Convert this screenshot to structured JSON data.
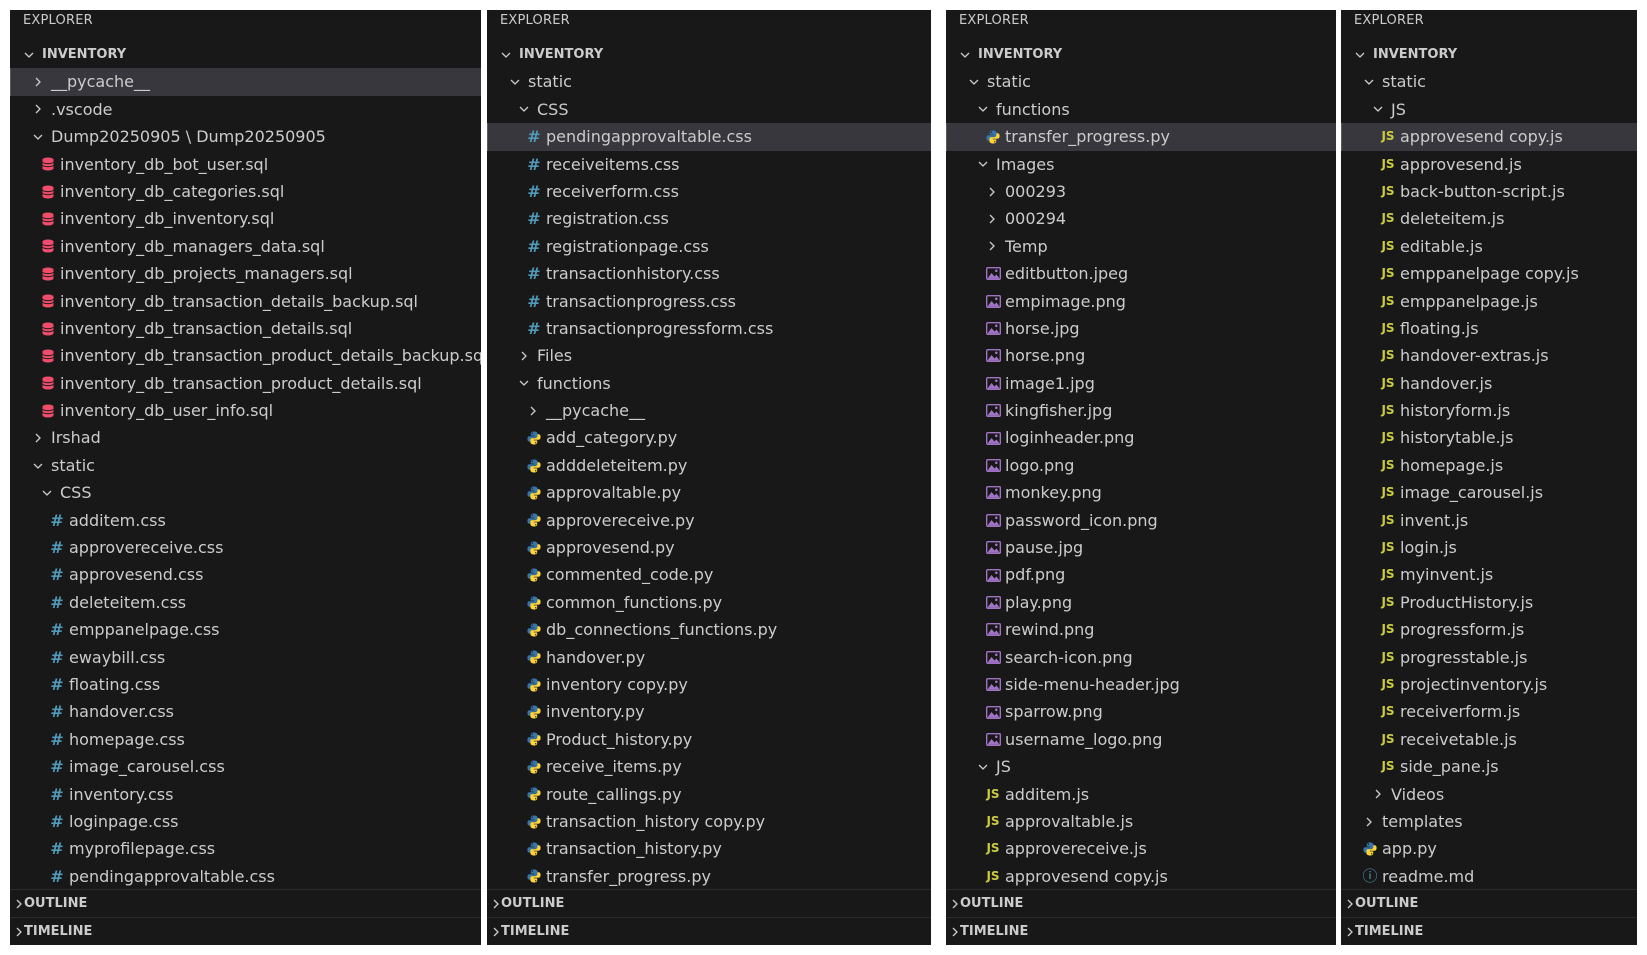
{
  "colors": {
    "panel_bg": "#181818",
    "selected_row": "#37373d",
    "css_hash": "#519aba",
    "js_badge": "#cbcb41",
    "python_blue": "#3776ab",
    "python_yellow": "#ffd43b",
    "database": "#f14c6c",
    "image": "#a074c4"
  },
  "panels": [
    {
      "header": "EXPLORER",
      "rows": [
        {
          "label": "INVENTORY",
          "depth": 0,
          "kind": "root",
          "icon": "chevron-down"
        },
        {
          "label": "__pycache__",
          "depth": 1,
          "kind": "folder",
          "icon": "chevron-right",
          "selected": true
        },
        {
          "label": ".vscode",
          "depth": 1,
          "kind": "folder",
          "icon": "chevron-right"
        },
        {
          "label": "Dump20250905 \\ Dump20250905",
          "depth": 1,
          "kind": "folder",
          "icon": "chevron-down"
        },
        {
          "label": "inventory_db_bot_user.sql",
          "depth": 2,
          "kind": "file",
          "icon": "database"
        },
        {
          "label": "inventory_db_categories.sql",
          "depth": 2,
          "kind": "file",
          "icon": "database"
        },
        {
          "label": "inventory_db_inventory.sql",
          "depth": 2,
          "kind": "file",
          "icon": "database"
        },
        {
          "label": "inventory_db_managers_data.sql",
          "depth": 2,
          "kind": "file",
          "icon": "database"
        },
        {
          "label": "inventory_db_projects_managers.sql",
          "depth": 2,
          "kind": "file",
          "icon": "database"
        },
        {
          "label": "inventory_db_transaction_details_backup.sql",
          "depth": 2,
          "kind": "file",
          "icon": "database"
        },
        {
          "label": "inventory_db_transaction_details.sql",
          "depth": 2,
          "kind": "file",
          "icon": "database"
        },
        {
          "label": "inventory_db_transaction_product_details_backup.sql",
          "depth": 2,
          "kind": "file",
          "icon": "database"
        },
        {
          "label": "inventory_db_transaction_product_details.sql",
          "depth": 2,
          "kind": "file",
          "icon": "database"
        },
        {
          "label": "inventory_db_user_info.sql",
          "depth": 2,
          "kind": "file",
          "icon": "database"
        },
        {
          "label": "Irshad",
          "depth": 1,
          "kind": "folder",
          "icon": "chevron-right"
        },
        {
          "label": "static",
          "depth": 1,
          "kind": "folder",
          "icon": "chevron-down"
        },
        {
          "label": "CSS",
          "depth": 2,
          "kind": "folder",
          "icon": "chevron-down"
        },
        {
          "label": "additem.css",
          "depth": 3,
          "kind": "file",
          "icon": "css"
        },
        {
          "label": "approvereceive.css",
          "depth": 3,
          "kind": "file",
          "icon": "css"
        },
        {
          "label": "approvesend.css",
          "depth": 3,
          "kind": "file",
          "icon": "css"
        },
        {
          "label": "deleteitem.css",
          "depth": 3,
          "kind": "file",
          "icon": "css"
        },
        {
          "label": "emppanelpage.css",
          "depth": 3,
          "kind": "file",
          "icon": "css"
        },
        {
          "label": "ewaybill.css",
          "depth": 3,
          "kind": "file",
          "icon": "css"
        },
        {
          "label": "floating.css",
          "depth": 3,
          "kind": "file",
          "icon": "css"
        },
        {
          "label": "handover.css",
          "depth": 3,
          "kind": "file",
          "icon": "css"
        },
        {
          "label": "homepage.css",
          "depth": 3,
          "kind": "file",
          "icon": "css"
        },
        {
          "label": "image_carousel.css",
          "depth": 3,
          "kind": "file",
          "icon": "css"
        },
        {
          "label": "inventory.css",
          "depth": 3,
          "kind": "file",
          "icon": "css"
        },
        {
          "label": "loginpage.css",
          "depth": 3,
          "kind": "file",
          "icon": "css"
        },
        {
          "label": "myprofilepage.css",
          "depth": 3,
          "kind": "file",
          "icon": "css"
        },
        {
          "label": "pendingapprovaltable.css",
          "depth": 3,
          "kind": "file",
          "icon": "css"
        }
      ],
      "sections": [
        {
          "label": "OUTLINE",
          "icon": "chevron-right"
        },
        {
          "label": "TIMELINE",
          "icon": "chevron-right"
        }
      ]
    },
    {
      "header": "EXPLORER",
      "rows": [
        {
          "label": "INVENTORY",
          "depth": 0,
          "kind": "root",
          "icon": "chevron-down"
        },
        {
          "label": "static",
          "depth": 1,
          "kind": "folder",
          "icon": "chevron-down"
        },
        {
          "label": "CSS",
          "depth": 2,
          "kind": "folder",
          "icon": "chevron-down"
        },
        {
          "label": "pendingapprovaltable.css",
          "depth": 3,
          "kind": "file",
          "icon": "css",
          "selected": true
        },
        {
          "label": "receiveitems.css",
          "depth": 3,
          "kind": "file",
          "icon": "css"
        },
        {
          "label": "receiverform.css",
          "depth": 3,
          "kind": "file",
          "icon": "css"
        },
        {
          "label": "registration.css",
          "depth": 3,
          "kind": "file",
          "icon": "css"
        },
        {
          "label": "registrationpage.css",
          "depth": 3,
          "kind": "file",
          "icon": "css"
        },
        {
          "label": "transactionhistory.css",
          "depth": 3,
          "kind": "file",
          "icon": "css"
        },
        {
          "label": "transactionprogress.css",
          "depth": 3,
          "kind": "file",
          "icon": "css"
        },
        {
          "label": "transactionprogressform.css",
          "depth": 3,
          "kind": "file",
          "icon": "css"
        },
        {
          "label": "Files",
          "depth": 2,
          "kind": "folder",
          "icon": "chevron-right"
        },
        {
          "label": "functions",
          "depth": 2,
          "kind": "folder",
          "icon": "chevron-down"
        },
        {
          "label": "__pycache__",
          "depth": 3,
          "kind": "folder",
          "icon": "chevron-right"
        },
        {
          "label": "add_category.py",
          "depth": 3,
          "kind": "file",
          "icon": "python"
        },
        {
          "label": "adddeleteitem.py",
          "depth": 3,
          "kind": "file",
          "icon": "python"
        },
        {
          "label": "approvaltable.py",
          "depth": 3,
          "kind": "file",
          "icon": "python"
        },
        {
          "label": "approvereceive.py",
          "depth": 3,
          "kind": "file",
          "icon": "python"
        },
        {
          "label": "approvesend.py",
          "depth": 3,
          "kind": "file",
          "icon": "python"
        },
        {
          "label": "commented_code.py",
          "depth": 3,
          "kind": "file",
          "icon": "python"
        },
        {
          "label": "common_functions.py",
          "depth": 3,
          "kind": "file",
          "icon": "python"
        },
        {
          "label": "db_connections_functions.py",
          "depth": 3,
          "kind": "file",
          "icon": "python"
        },
        {
          "label": "handover.py",
          "depth": 3,
          "kind": "file",
          "icon": "python"
        },
        {
          "label": "inventory copy.py",
          "depth": 3,
          "kind": "file",
          "icon": "python"
        },
        {
          "label": "inventory.py",
          "depth": 3,
          "kind": "file",
          "icon": "python"
        },
        {
          "label": "Product_history.py",
          "depth": 3,
          "kind": "file",
          "icon": "python"
        },
        {
          "label": "receive_items.py",
          "depth": 3,
          "kind": "file",
          "icon": "python"
        },
        {
          "label": "route_callings.py",
          "depth": 3,
          "kind": "file",
          "icon": "python"
        },
        {
          "label": "transaction_history copy.py",
          "depth": 3,
          "kind": "file",
          "icon": "python"
        },
        {
          "label": "transaction_history.py",
          "depth": 3,
          "kind": "file",
          "icon": "python"
        },
        {
          "label": "transfer_progress.py",
          "depth": 3,
          "kind": "file",
          "icon": "python"
        }
      ],
      "sections": [
        {
          "label": "OUTLINE",
          "icon": "chevron-right"
        },
        {
          "label": "TIMELINE",
          "icon": "chevron-right"
        }
      ]
    },
    {
      "header": "EXPLORER",
      "rows": [
        {
          "label": "INVENTORY",
          "depth": 0,
          "kind": "root",
          "icon": "chevron-down"
        },
        {
          "label": "static",
          "depth": 1,
          "kind": "folder",
          "icon": "chevron-down"
        },
        {
          "label": "functions",
          "depth": 2,
          "kind": "folder",
          "icon": "chevron-down"
        },
        {
          "label": "transfer_progress.py",
          "depth": 3,
          "kind": "file",
          "icon": "python",
          "selected": true
        },
        {
          "label": "Images",
          "depth": 2,
          "kind": "folder",
          "icon": "chevron-down"
        },
        {
          "label": "000293",
          "depth": 3,
          "kind": "folder",
          "icon": "chevron-right"
        },
        {
          "label": "000294",
          "depth": 3,
          "kind": "folder",
          "icon": "chevron-right"
        },
        {
          "label": "Temp",
          "depth": 3,
          "kind": "folder",
          "icon": "chevron-right"
        },
        {
          "label": "editbutton.jpeg",
          "depth": 3,
          "kind": "file",
          "icon": "image"
        },
        {
          "label": "empimage.png",
          "depth": 3,
          "kind": "file",
          "icon": "image"
        },
        {
          "label": "horse.jpg",
          "depth": 3,
          "kind": "file",
          "icon": "image"
        },
        {
          "label": "horse.png",
          "depth": 3,
          "kind": "file",
          "icon": "image"
        },
        {
          "label": "image1.jpg",
          "depth": 3,
          "kind": "file",
          "icon": "image"
        },
        {
          "label": "kingfisher.jpg",
          "depth": 3,
          "kind": "file",
          "icon": "image"
        },
        {
          "label": "loginheader.png",
          "depth": 3,
          "kind": "file",
          "icon": "image"
        },
        {
          "label": "logo.png",
          "depth": 3,
          "kind": "file",
          "icon": "image"
        },
        {
          "label": "monkey.png",
          "depth": 3,
          "kind": "file",
          "icon": "image"
        },
        {
          "label": "password_icon.png",
          "depth": 3,
          "kind": "file",
          "icon": "image"
        },
        {
          "label": "pause.jpg",
          "depth": 3,
          "kind": "file",
          "icon": "image"
        },
        {
          "label": "pdf.png",
          "depth": 3,
          "kind": "file",
          "icon": "image"
        },
        {
          "label": "play.png",
          "depth": 3,
          "kind": "file",
          "icon": "image"
        },
        {
          "label": "rewind.png",
          "depth": 3,
          "kind": "file",
          "icon": "image"
        },
        {
          "label": "search-icon.png",
          "depth": 3,
          "kind": "file",
          "icon": "image"
        },
        {
          "label": "side-menu-header.jpg",
          "depth": 3,
          "kind": "file",
          "icon": "image"
        },
        {
          "label": "sparrow.png",
          "depth": 3,
          "kind": "file",
          "icon": "image"
        },
        {
          "label": "username_logo.png",
          "depth": 3,
          "kind": "file",
          "icon": "image"
        },
        {
          "label": "JS",
          "depth": 2,
          "kind": "folder",
          "icon": "chevron-down"
        },
        {
          "label": "additem.js",
          "depth": 3,
          "kind": "file",
          "icon": "js"
        },
        {
          "label": "approvaltable.js",
          "depth": 3,
          "kind": "file",
          "icon": "js"
        },
        {
          "label": "approvereceive.js",
          "depth": 3,
          "kind": "file",
          "icon": "js"
        },
        {
          "label": "approvesend copy.js",
          "depth": 3,
          "kind": "file",
          "icon": "js"
        }
      ],
      "sections": [
        {
          "label": "OUTLINE",
          "icon": "chevron-right"
        },
        {
          "label": "TIMELINE",
          "icon": "chevron-right"
        }
      ]
    },
    {
      "header": "EXPLORER",
      "rows": [
        {
          "label": "INVENTORY",
          "depth": 0,
          "kind": "root",
          "icon": "chevron-down"
        },
        {
          "label": "static",
          "depth": 1,
          "kind": "folder",
          "icon": "chevron-down"
        },
        {
          "label": "JS",
          "depth": 2,
          "kind": "folder",
          "icon": "chevron-down"
        },
        {
          "label": "approvesend copy.js",
          "depth": 3,
          "kind": "file",
          "icon": "js",
          "selected": true
        },
        {
          "label": "approvesend.js",
          "depth": 3,
          "kind": "file",
          "icon": "js"
        },
        {
          "label": "back-button-script.js",
          "depth": 3,
          "kind": "file",
          "icon": "js"
        },
        {
          "label": "deleteitem.js",
          "depth": 3,
          "kind": "file",
          "icon": "js"
        },
        {
          "label": "editable.js",
          "depth": 3,
          "kind": "file",
          "icon": "js"
        },
        {
          "label": "emppanelpage copy.js",
          "depth": 3,
          "kind": "file",
          "icon": "js"
        },
        {
          "label": "emppanelpage.js",
          "depth": 3,
          "kind": "file",
          "icon": "js"
        },
        {
          "label": "floating.js",
          "depth": 3,
          "kind": "file",
          "icon": "js"
        },
        {
          "label": "handover-extras.js",
          "depth": 3,
          "kind": "file",
          "icon": "js"
        },
        {
          "label": "handover.js",
          "depth": 3,
          "kind": "file",
          "icon": "js"
        },
        {
          "label": "historyform.js",
          "depth": 3,
          "kind": "file",
          "icon": "js"
        },
        {
          "label": "historytable.js",
          "depth": 3,
          "kind": "file",
          "icon": "js"
        },
        {
          "label": "homepage.js",
          "depth": 3,
          "kind": "file",
          "icon": "js"
        },
        {
          "label": "image_carousel.js",
          "depth": 3,
          "kind": "file",
          "icon": "js"
        },
        {
          "label": "invent.js",
          "depth": 3,
          "kind": "file",
          "icon": "js"
        },
        {
          "label": "login.js",
          "depth": 3,
          "kind": "file",
          "icon": "js"
        },
        {
          "label": "myinvent.js",
          "depth": 3,
          "kind": "file",
          "icon": "js"
        },
        {
          "label": "ProductHistory.js",
          "depth": 3,
          "kind": "file",
          "icon": "js"
        },
        {
          "label": "progressform.js",
          "depth": 3,
          "kind": "file",
          "icon": "js"
        },
        {
          "label": "progresstable.js",
          "depth": 3,
          "kind": "file",
          "icon": "js"
        },
        {
          "label": "projectinventory.js",
          "depth": 3,
          "kind": "file",
          "icon": "js"
        },
        {
          "label": "receiverform.js",
          "depth": 3,
          "kind": "file",
          "icon": "js"
        },
        {
          "label": "receivetable.js",
          "depth": 3,
          "kind": "file",
          "icon": "js"
        },
        {
          "label": "side_pane.js",
          "depth": 3,
          "kind": "file",
          "icon": "js"
        },
        {
          "label": "Videos",
          "depth": 2,
          "kind": "folder",
          "icon": "chevron-right"
        },
        {
          "label": "templates",
          "depth": 1,
          "kind": "folder",
          "icon": "chevron-right"
        },
        {
          "label": "app.py",
          "depth": 1,
          "kind": "file",
          "icon": "python"
        },
        {
          "label": "readme.md",
          "depth": 1,
          "kind": "file",
          "icon": "info"
        }
      ],
      "sections": [
        {
          "label": "OUTLINE",
          "icon": "chevron-right"
        },
        {
          "label": "TIMELINE",
          "icon": "chevron-right"
        }
      ]
    }
  ]
}
